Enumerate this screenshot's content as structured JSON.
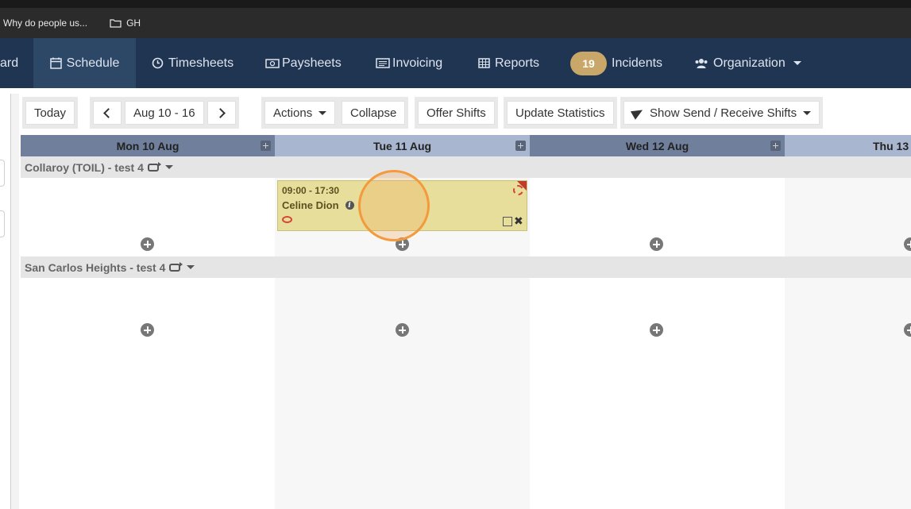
{
  "bookmarks": {
    "item1": "Why do people us...",
    "folder": "GH"
  },
  "nav": {
    "dashboard": "ard",
    "schedule": "Schedule",
    "timesheets": "Timesheets",
    "paysheets": "Paysheets",
    "invoicing": "Invoicing",
    "reports": "Reports",
    "incidents_count": "19",
    "incidents": "Incidents",
    "organization": "Organization"
  },
  "toolbar": {
    "today": "Today",
    "range": "Aug 10 - 16",
    "actions": "Actions",
    "collapse": "Collapse",
    "offer_shifts": "Offer Shifts",
    "update_statistics": "Update Statistics",
    "send_receive": "Show Send / Receive Shifts"
  },
  "calendar": {
    "days": [
      "Mon 10 Aug",
      "Tue 11 Aug",
      "Wed 12 Aug",
      "Thu 13"
    ],
    "groups": [
      {
        "name": "Collaroy (TOIL) - test 4"
      },
      {
        "name": "San Carlos Heights - test 4"
      }
    ],
    "shift": {
      "time": "09:00 - 17:30",
      "employee": "Celine Dion"
    }
  },
  "colors": {
    "navbar": "#1f3552",
    "badge": "#c8a769",
    "shift_bg": "#e6de9a",
    "click_marker": "#f39a3d"
  }
}
